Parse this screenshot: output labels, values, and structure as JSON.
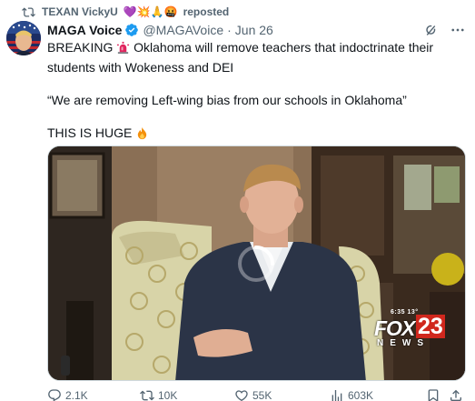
{
  "repost": {
    "user": "TEXAN VickyU",
    "emojis": "💜💥🙏🤬",
    "label": "reposted"
  },
  "tweet": {
    "author_name": "MAGA Voice",
    "handle": "@MAGAVoice",
    "separator": "·",
    "date": "Jun 26",
    "line1_prefix": "BREAKING",
    "line1_rest": " Oklahoma will remove teachers that indoctrinate their students with Wokeness and DEI",
    "quote": "“We are removing Left-wing bias from our schools in Oklahoma”",
    "closing": "THIS IS HUGE"
  },
  "video": {
    "logo_time": "6:35  13°",
    "logo_brand": "FOX",
    "logo_number": "23",
    "logo_news": "NEWS"
  },
  "actions": {
    "replies": "2.1K",
    "reposts": "10K",
    "likes": "55K",
    "views": "603K"
  },
  "colors": {
    "verified": "#1d9bf0",
    "text_secondary": "#536471",
    "siren": "#e0245e"
  }
}
